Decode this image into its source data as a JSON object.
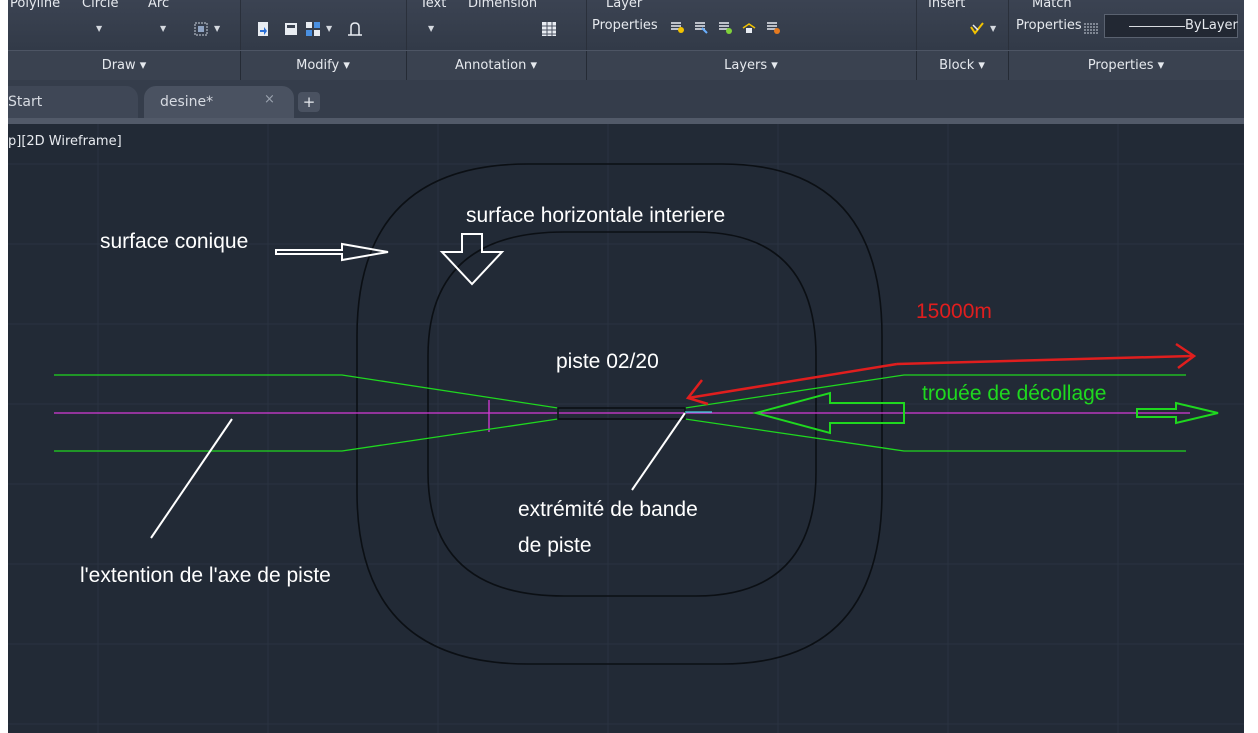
{
  "ribbon": {
    "draw_tools": {
      "polyline": "Polyline",
      "circle": "Circle",
      "arc": "Arc"
    },
    "annotation_tools": {
      "text": "Text",
      "dimension": "Dimension"
    },
    "layer_tools": {
      "layer_label_top": "Layer",
      "layer_label_bottom": "Properties"
    },
    "block_tools": {
      "insert": "Insert"
    },
    "properties_tools": {
      "match_top": "Match",
      "match_bottom": "Properties",
      "linetype_value": "ByLayer"
    },
    "panels": {
      "draw": "Draw ▾",
      "modify": "Modify ▾",
      "annotation": "Annotation ▾",
      "layers": "Layers ▾",
      "block": "Block ▾",
      "properties": "Properties ▾"
    },
    "icons": [
      "region-icon",
      "insert-block-icon",
      "save-block-icon",
      "grid-array-icon",
      "offset-icon",
      "table-icon",
      "layer-on-icon",
      "layer-off-icon",
      "layer-freeze-icon",
      "layer-lock-icon",
      "layer-iso-icon",
      "match-properties-icon"
    ]
  },
  "tabs": {
    "start": "Start",
    "desine": "desine*",
    "close_glyph": "×",
    "add_glyph": "+"
  },
  "viewport": {
    "label": "p][2D Wireframe]"
  },
  "drawing": {
    "labels": {
      "conique": "surface conique",
      "horizontale": "surface horizontale interiere",
      "piste": "piste 02/20",
      "extremite_1": "extrémité de bande",
      "extremite_2": "de piste",
      "axe": "l'extention de l'axe de piste",
      "distance": "15000m",
      "trouee": "trouée de décollage"
    },
    "colors": {
      "background": "#222a36",
      "outline": "#0b0f14",
      "green": "#1fd81f",
      "magenta": "#d53ad8",
      "red": "#e01e1e",
      "white": "#ffffff"
    }
  }
}
